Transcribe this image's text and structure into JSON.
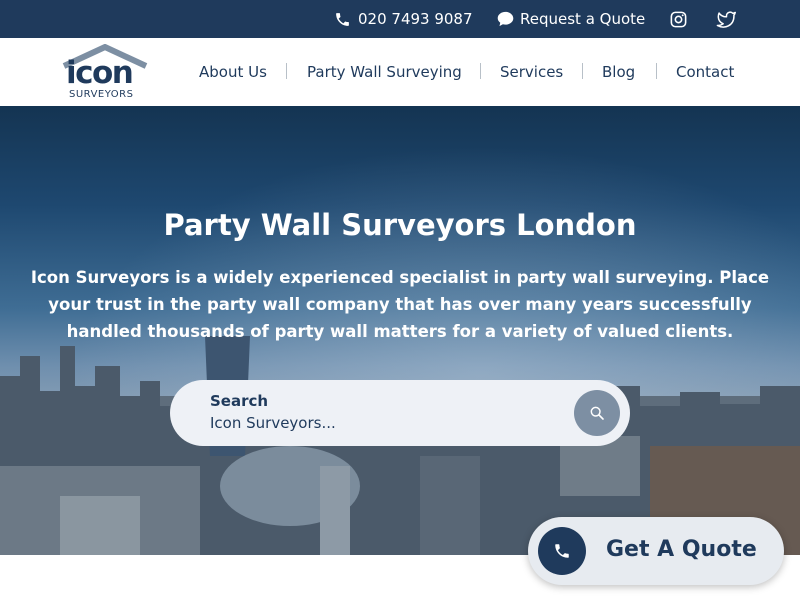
{
  "topbar": {
    "phone": "020 7493 9087",
    "quote": "Request a Quote",
    "icons": [
      "phone-icon",
      "chat-bubble-icon",
      "instagram-icon",
      "twitter-icon"
    ]
  },
  "logo": {
    "word": "icon",
    "sub": "SURVEYORS"
  },
  "nav": {
    "items": [
      {
        "label": "About Us"
      },
      {
        "label": "Party Wall Surveying"
      },
      {
        "label": "Services"
      },
      {
        "label": "Blog"
      },
      {
        "label": "Contact"
      }
    ]
  },
  "hero": {
    "title": "Party Wall Surveyors London",
    "text": "Icon Surveyors is a widely experienced specialist in party wall surveying. Place your trust in the party wall company that has over many years successfully handled thousands of party wall matters for a variety of valued clients."
  },
  "search": {
    "label": "Search",
    "placeholder": "Icon Surveyors..."
  },
  "cta": {
    "label": "Get A Quote"
  },
  "colors": {
    "navy": "#1f3a5c",
    "search_button": "#7d8fa3",
    "pill_bg": "#e7ebf0"
  }
}
